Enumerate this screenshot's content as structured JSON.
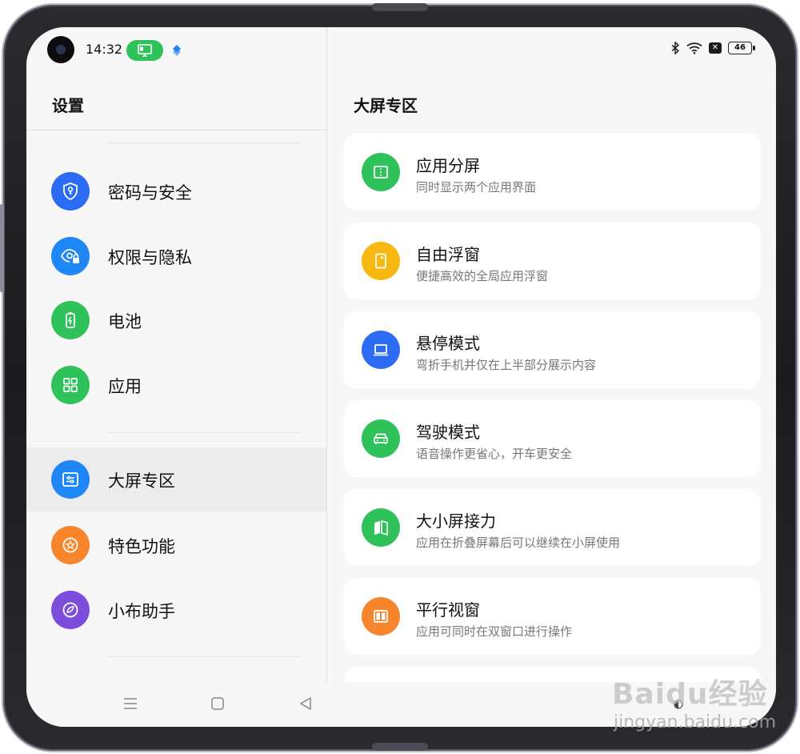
{
  "status_bar": {
    "time": "14:32",
    "battery_level": "46",
    "sim_badge": "✕"
  },
  "left_pane": {
    "title": "设置",
    "items": [
      {
        "label": "密码与安全",
        "icon": "shield-key-icon",
        "color": "#2b6cf2"
      },
      {
        "label": "权限与隐私",
        "icon": "eye-lock-icon",
        "color": "#1f87f5"
      },
      {
        "label": "电池",
        "icon": "battery-icon",
        "color": "#2fc15a"
      },
      {
        "label": "应用",
        "icon": "apps-grid-icon",
        "color": "#2fc15a"
      },
      {
        "label": "大屏专区",
        "icon": "sliders-icon",
        "color": "#1f87f5",
        "selected": true
      },
      {
        "label": "特色功能",
        "icon": "star-circle-icon",
        "color": "#f7852b"
      },
      {
        "label": "小布助手",
        "icon": "assistant-icon",
        "color": "#7c4ddb"
      }
    ]
  },
  "right_pane": {
    "title": "大屏专区",
    "cards": [
      {
        "title": "应用分屏",
        "subtitle": "同时显示两个应用界面",
        "icon": "split-screen-icon",
        "color": "#2fc15a"
      },
      {
        "title": "自由浮窗",
        "subtitle": "便捷高效的全局应用浮窗",
        "icon": "floating-window-icon",
        "color": "#f7b812"
      },
      {
        "title": "悬停模式",
        "subtitle": "弯折手机并仅在上半部分展示内容",
        "icon": "laptop-icon",
        "color": "#2b6cf2"
      },
      {
        "title": "驾驶模式",
        "subtitle": "语音操作更省心，开车更安全",
        "icon": "car-icon",
        "color": "#2fc15a"
      },
      {
        "title": "大小屏接力",
        "subtitle": "应用在折叠屏幕后可以继续在小屏使用",
        "icon": "book-icon",
        "color": "#2fc15a"
      },
      {
        "title": "平行视窗",
        "subtitle": "应用可同时在双窗口进行操作",
        "icon": "parallel-window-icon",
        "color": "#f7852b"
      }
    ]
  },
  "nav_bar": {
    "menu": "☰",
    "home": "□",
    "back": "◁"
  },
  "watermark": {
    "main": "Baidu经验",
    "sub": "jingyan.baidu.com"
  }
}
